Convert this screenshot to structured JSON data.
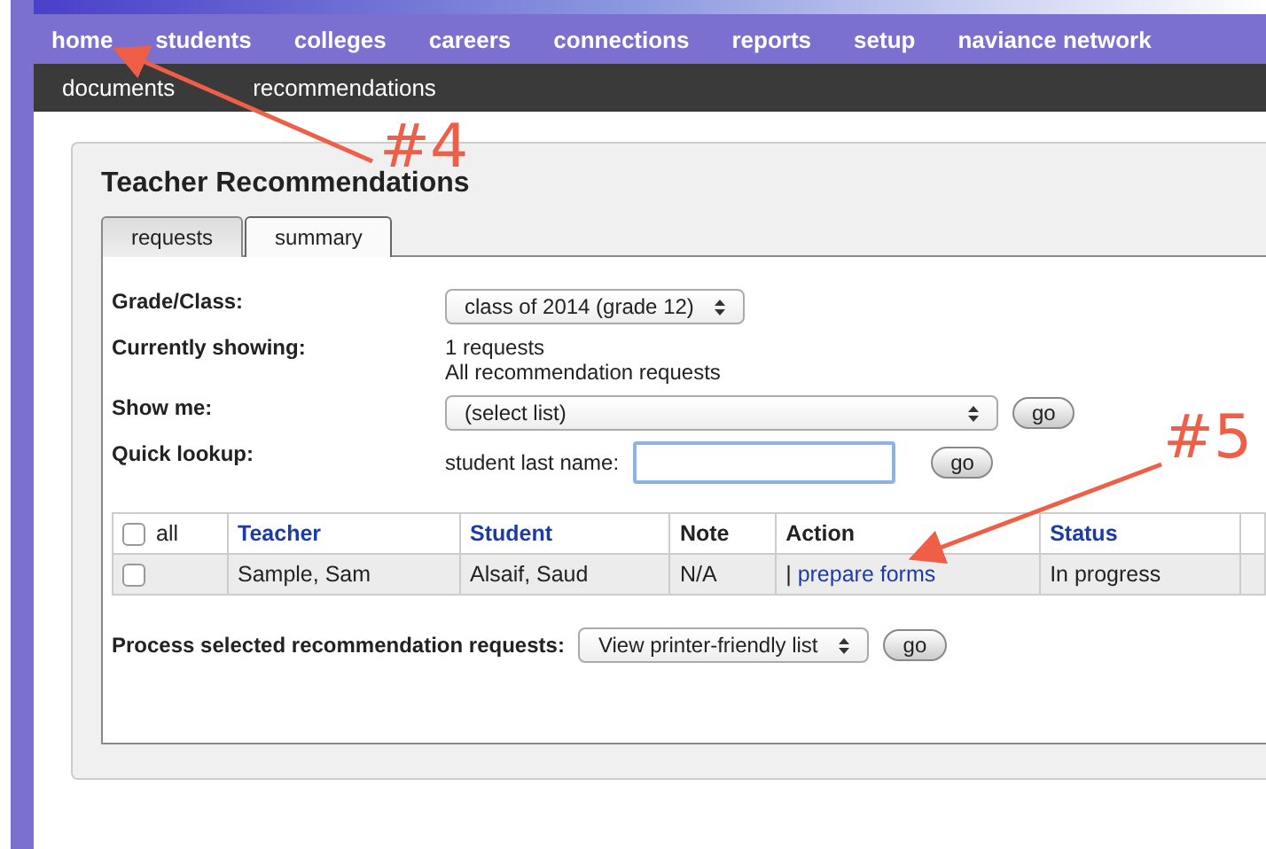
{
  "nav": {
    "items": [
      "home",
      "students",
      "colleges",
      "careers",
      "connections",
      "reports",
      "setup",
      "naviance network"
    ]
  },
  "subnav": {
    "items": [
      "documents",
      "recommendations"
    ]
  },
  "panel": {
    "title": "Teacher Recommendations",
    "tabs": [
      {
        "label": "requests",
        "selected": true
      },
      {
        "label": "summary",
        "selected": false
      }
    ],
    "form": [
      {
        "kind": "select",
        "label": "Grade/Class:",
        "value": "class of 2014 (grade 12)"
      },
      {
        "kind": "text",
        "label": "Currently showing:",
        "lines": [
          "1 requests",
          "All recommendation requests"
        ]
      },
      {
        "kind": "select-go",
        "label": "Show me:",
        "value": "(select list)",
        "button": "go"
      },
      {
        "kind": "lookup",
        "label": "Quick lookup:",
        "prefix": "student last name:",
        "button": "go"
      }
    ],
    "table": {
      "columns": [
        {
          "label": "all",
          "kind": "check",
          "checked": false
        },
        {
          "label": "Teacher",
          "kind": "link"
        },
        {
          "label": "Student",
          "kind": "link"
        },
        {
          "label": "Note",
          "kind": "plain"
        },
        {
          "label": "Action",
          "kind": "plain"
        },
        {
          "label": "Status",
          "kind": "link"
        }
      ],
      "rows": [
        {
          "checked": false,
          "teacher": "Sample, Sam",
          "student": "Alsaif, Saud",
          "note": "N/A",
          "action_sep": "|",
          "action": "prepare forms",
          "status": "In progress"
        }
      ]
    },
    "process": {
      "label": "Process selected recommendation requests:",
      "value": "View printer-friendly list",
      "button": "go"
    }
  },
  "annotations": [
    {
      "label": "#4"
    },
    {
      "label": "#5"
    }
  ]
}
